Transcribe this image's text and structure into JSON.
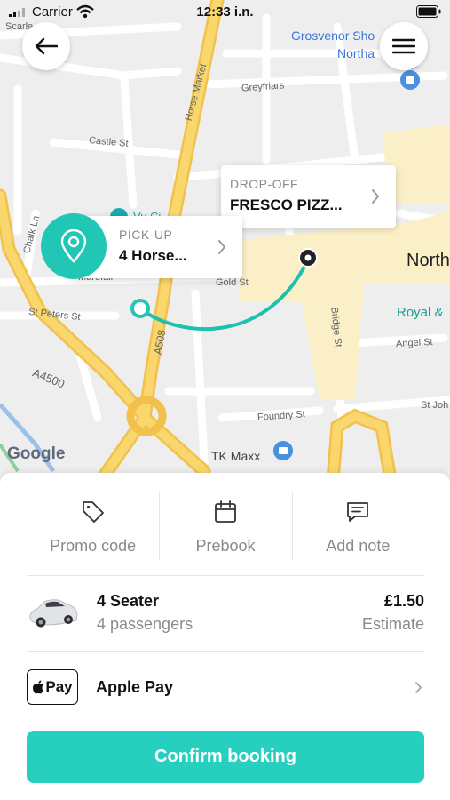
{
  "status_bar": {
    "carrier": "Carrier",
    "time": "12:33 i.n."
  },
  "map": {
    "labels": {
      "scarletwell": "Scarle",
      "grosvenor": "Grosvenor Sho",
      "northampton_partial": "Northa",
      "greyfriars": "Greyfriars",
      "horse_market": "Horse Market",
      "castle_st": "Castle St",
      "chalk_ln": "Chalk Ln",
      "gold_st": "Gold St",
      "marefair": "Marefair",
      "st_peters_st": "St Peters St",
      "bridge_st": "Bridge St",
      "a508": "A508",
      "a4500": "A4500",
      "angel_st": "Angel St",
      "foundry_st": "Foundry St",
      "st_john": "St Joh",
      "north_big": "North",
      "royal_and": "Royal &",
      "tk_maxx": "TK Maxx",
      "vue_partial": "Vu Ci",
      "google": "Google"
    },
    "colors": {
      "route": "#1fc1ae",
      "pin": "#21c7b4",
      "major_road": "#f6cd55"
    },
    "pickup": {
      "caption": "PICK-UP",
      "value": "4 Horse..."
    },
    "dropoff": {
      "caption": "DROP-OFF",
      "value": "FRESCO PIZZ..."
    }
  },
  "actions": [
    {
      "label": "Promo code",
      "icon": "tag-icon"
    },
    {
      "label": "Prebook",
      "icon": "calendar-icon"
    },
    {
      "label": "Add note",
      "icon": "note-icon"
    }
  ],
  "vehicle": {
    "name": "4 Seater",
    "passengers": "4 passengers",
    "price": "£1.50",
    "price_note": "Estimate"
  },
  "payment": {
    "badge_text": "Pay",
    "label": "Apple Pay"
  },
  "confirm_label": "Confirm booking"
}
